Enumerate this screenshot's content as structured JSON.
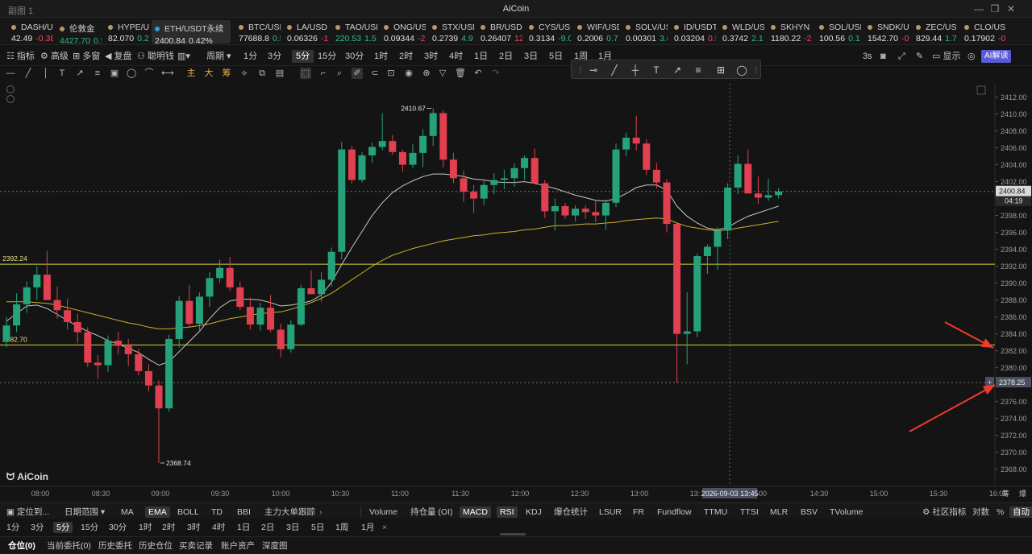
{
  "titlebar": {
    "window_label": "副图 1",
    "app_title": "AiCoin"
  },
  "tickers": [
    {
      "name": "DASH/U",
      "price": "42.49",
      "change": "-0.38",
      "dir": "dn"
    },
    {
      "name": "伦敦金",
      "price": "4427.70",
      "change": "0.5",
      "dir": "up"
    },
    {
      "name": "HYPE/U",
      "price": "82.070",
      "change": "0.2",
      "dir": "up"
    },
    {
      "name": "ETH/USDT永续",
      "price": "2400.84",
      "change": "0.42%",
      "dir": "up"
    },
    {
      "name": "BTC/USD",
      "price": "77688.8",
      "change": "0.5",
      "dir": "up"
    },
    {
      "name": "LA/USD",
      "price": "0.06326",
      "change": "-1",
      "dir": "dn"
    },
    {
      "name": "TAO/USD",
      "price": "220.53",
      "change": "1.5",
      "dir": "up"
    },
    {
      "name": "ONG/US",
      "price": "0.09344",
      "change": "-2",
      "dir": "dn"
    },
    {
      "name": "STX/USD",
      "price": "0.2739",
      "change": "4.9",
      "dir": "up"
    },
    {
      "name": "BR/USD",
      "price": "0.26407",
      "change": "12",
      "dir": "dn"
    },
    {
      "name": "CYS/USD",
      "price": "0.3134",
      "change": "-9.0",
      "dir": "up"
    },
    {
      "name": "WIF/USD",
      "price": "0.2006",
      "change": "0.7",
      "dir": "up"
    },
    {
      "name": "SOLV/US",
      "price": "0.00301",
      "change": "3.6",
      "dir": "up"
    },
    {
      "name": "ID/USDT",
      "price": "0.03204",
      "change": "0.5",
      "dir": "dn"
    },
    {
      "name": "WLD/US",
      "price": "0.3742",
      "change": "2.1",
      "dir": "up"
    },
    {
      "name": "SKHYN",
      "price": "1180.22",
      "change": "-2",
      "dir": "dn"
    },
    {
      "name": "SOL/USD",
      "price": "100.56",
      "change": "0.1",
      "dir": "up"
    },
    {
      "name": "SNDK/U",
      "price": "1542.70",
      "change": "-0",
      "dir": "dn"
    },
    {
      "name": "ZEC/US",
      "price": "829.44",
      "change": "1.7",
      "dir": "up"
    },
    {
      "name": "CLO/US",
      "price": "0.17902",
      "change": "-0",
      "dir": "dn"
    }
  ],
  "toolbar1": {
    "indicators": "指标",
    "advanced": "高级",
    "multi": "多窗",
    "replay": "复盘",
    "smart_money": "聪明钱",
    "period": "周期",
    "intervals": [
      "1分",
      "3分",
      "5分",
      "15分",
      "30分",
      "1时",
      "2时",
      "3时",
      "4时",
      "1日",
      "2日",
      "3日",
      "5日",
      "1周",
      "1月"
    ],
    "selected_interval": "5分",
    "refresh": "3s",
    "display": "显示",
    "ai": "AI解读"
  },
  "chart": {
    "watermark": "AiCoin",
    "hline_top_label": "2392.24",
    "hline_bottom_label": "2382.70",
    "high_label": "2410.67",
    "low_label": "2368.74",
    "current_price": "2400.84",
    "countdown": "04:19",
    "cursor_price": "2378.25",
    "cursor_time": "2026-09-03 13:45",
    "time_labels": [
      "08:00",
      "08:30",
      "09:00",
      "09:30",
      "10:00",
      "10:30",
      "11:00",
      "11:30",
      "12:00",
      "12:30",
      "13:00",
      "13:",
      "00",
      "14:30",
      "15:00",
      "15:30",
      "16:00"
    ],
    "price_labels": [
      "2412.00",
      "2410.00",
      "2408.00",
      "2406.00",
      "2404.00",
      "2402.00",
      "2398.00",
      "2396.00",
      "2394.00",
      "2392.00",
      "2390.00",
      "2388.00",
      "2386.00",
      "2384.00",
      "2382.00",
      "2380.00",
      "2376.00",
      "2374.00",
      "2372.00",
      "2370.00",
      "2368.00"
    ],
    "corner_labels": [
      "筹",
      "爆"
    ]
  },
  "chart_data": {
    "type": "candlestick",
    "title": "ETH/USDT永续 5分",
    "candles": [
      [
        2383.2,
        2386,
        2382.4,
        2385
      ],
      [
        2385,
        2388.8,
        2384.2,
        2387.5
      ],
      [
        2387.5,
        2390.2,
        2386.5,
        2389.5
      ],
      [
        2389.5,
        2392,
        2388,
        2391
      ],
      [
        2391,
        2393.8,
        2389.2,
        2388
      ],
      [
        2388,
        2389.6,
        2385.8,
        2386.8
      ],
      [
        2386.8,
        2388.2,
        2384.5,
        2385.4
      ],
      [
        2385.4,
        2386.4,
        2382.9,
        2384.2
      ],
      [
        2384.2,
        2384.8,
        2380.1,
        2380.6
      ],
      [
        2380.6,
        2381.5,
        2378.7,
        2380.3
      ],
      [
        2380.3,
        2383.8,
        2379.5,
        2383.2
      ],
      [
        2383.2,
        2384.2,
        2381.6,
        2382.6
      ],
      [
        2382.6,
        2383.4,
        2380.2,
        2381.6
      ],
      [
        2381.6,
        2382.2,
        2379.1,
        2379.6
      ],
      [
        2379.6,
        2380.4,
        2377.2,
        2377.9
      ],
      [
        2377.9,
        2378.5,
        2368.74,
        2375.2
      ],
      [
        2375.2,
        2383.9,
        2374.8,
        2383.4
      ],
      [
        2383.4,
        2388.5,
        2382.4,
        2387.9
      ],
      [
        2387.9,
        2389.8,
        2384.8,
        2385.2
      ],
      [
        2385.2,
        2388.9,
        2384.2,
        2388.4
      ],
      [
        2388.4,
        2391.3,
        2387.2,
        2390.6
      ],
      [
        2390.6,
        2392.8,
        2390,
        2391.8
      ],
      [
        2391.8,
        2393.1,
        2389.1,
        2389.5
      ],
      [
        2389.5,
        2390.2,
        2386.8,
        2387.2
      ],
      [
        2387.2,
        2388.3,
        2384.5,
        2385.1
      ],
      [
        2385.1,
        2387.7,
        2384.4,
        2387.1
      ],
      [
        2387.1,
        2388.6,
        2384.2,
        2384.5
      ],
      [
        2384.5,
        2385.2,
        2381.2,
        2382.2
      ],
      [
        2382.2,
        2385.6,
        2381.8,
        2385.1
      ],
      [
        2385.1,
        2389.8,
        2384.9,
        2389.4
      ],
      [
        2389.4,
        2391.5,
        2388.7,
        2388.7
      ],
      [
        2388.7,
        2391.3,
        2387.8,
        2390.4
      ],
      [
        2390.4,
        2394.2,
        2389.6,
        2393.7
      ],
      [
        2393.7,
        2406.7,
        2392.8,
        2405.8
      ],
      [
        2405.8,
        2406.2,
        2401.8,
        2402.2
      ],
      [
        2402.2,
        2405.5,
        2401.9,
        2405.1
      ],
      [
        2405.1,
        2406.6,
        2404.2,
        2406.1
      ],
      [
        2406.1,
        2410.1,
        2405.7,
        2406.8
      ],
      [
        2406.8,
        2407.5,
        2405.2,
        2405.5
      ],
      [
        2405.5,
        2405.8,
        2403.2,
        2404
      ],
      [
        2404,
        2406.4,
        2403.6,
        2405.4
      ],
      [
        2405.4,
        2408.2,
        2403.7,
        2407.4
      ],
      [
        2407.4,
        2410.67,
        2406.2,
        2410.1
      ],
      [
        2410.1,
        2410.4,
        2403.7,
        2404.6
      ],
      [
        2404.6,
        2405.4,
        2401.8,
        2402.4
      ],
      [
        2402.4,
        2403.3,
        2399.6,
        2400.8
      ],
      [
        2400.8,
        2401.6,
        2398.3,
        2400
      ],
      [
        2400,
        2402.1,
        2399.2,
        2401.6
      ],
      [
        2401.6,
        2403,
        2400.5,
        2402.2
      ],
      [
        2402.2,
        2403.4,
        2401.1,
        2402.4
      ],
      [
        2402.4,
        2404.2,
        2401.4,
        2403.6
      ],
      [
        2403.6,
        2405.1,
        2402.2,
        2404.8
      ],
      [
        2404.8,
        2405.9,
        2401.7,
        2401.8
      ],
      [
        2401.8,
        2402.2,
        2397.7,
        2398.5
      ],
      [
        2398.5,
        2400,
        2396.2,
        2399.1
      ],
      [
        2399.1,
        2399.5,
        2397.6,
        2398
      ],
      [
        2398,
        2399.2,
        2397.3,
        2398.8
      ],
      [
        2398.8,
        2399.2,
        2397.6,
        2398.4
      ],
      [
        2398.4,
        2399.8,
        2397.2,
        2398
      ],
      [
        2398,
        2399.9,
        2396.3,
        2399.5
      ],
      [
        2399.5,
        2406.5,
        2399,
        2405.8
      ],
      [
        2405.8,
        2407.8,
        2405,
        2407.2
      ],
      [
        2407.2,
        2409.8,
        2405.7,
        2406.5
      ],
      [
        2406.5,
        2407,
        2402.8,
        2403.4
      ],
      [
        2403.4,
        2404.2,
        2401.2,
        2401.9
      ],
      [
        2401.9,
        2402.3,
        2396,
        2397
      ],
      [
        2397,
        2397.2,
        2378.25,
        2384
      ],
      [
        2384,
        2388.9,
        2380.4,
        2384.3
      ],
      [
        2384.3,
        2393.5,
        2383.6,
        2393.2
      ],
      [
        2393.2,
        2394.6,
        2391.1,
        2394.3
      ],
      [
        2394.3,
        2396.6,
        2391.6,
        2396.2
      ],
      [
        2396.2,
        2401.8,
        2395.2,
        2401.3
      ],
      [
        2401.3,
        2405.1,
        2400.5,
        2404.1
      ],
      [
        2404.1,
        2405.8,
        2402.4,
        2400.6
      ],
      [
        2400.6,
        2402.6,
        2399.4,
        2400.1
      ],
      [
        2400.1,
        2402.3,
        2399.7,
        2400.4
      ],
      [
        2400.4,
        2401.2,
        2400,
        2400.84
      ]
    ],
    "ma_fast": [
      2385.5,
      2386.4,
      2387.3,
      2387.4,
      2387,
      2386.3,
      2385.6,
      2384.9,
      2384.3,
      2383.8,
      2383.2,
      2382.8,
      2382.3,
      2381.8,
      2381,
      2380.3,
      2380.7,
      2381.9,
      2383.1,
      2384.3,
      2385.8,
      2387.1,
      2387.9,
      2388.1,
      2388.1,
      2388,
      2387.7,
      2387.3,
      2387.4,
      2387.6,
      2387.9,
      2388.6,
      2390.1,
      2392.2,
      2394.2,
      2396.1,
      2398,
      2399.5,
      2400.7,
      2401.5,
      2402.1,
      2402.6,
      2402.9,
      2402.9,
      2402.8,
      2402.6,
      2402.3,
      2402.2,
      2402,
      2401.9,
      2401.9,
      2402,
      2401.8,
      2401.5,
      2401.2,
      2400.8,
      2400.4,
      2400.1,
      2399.8,
      2399.7,
      2400,
      2400.6,
      2401.3,
      2401.6,
      2401.6,
      2401,
      2399.1,
      2397.9,
      2397.1,
      2396.5,
      2396.3,
      2396.6,
      2397.3,
      2397.9,
      2398.3,
      2398.7,
      2399.1
    ],
    "ma_slow": [
      2387.8,
      2387.8,
      2387.8,
      2387.7,
      2387.6,
      2387.4,
      2387.1,
      2386.8,
      2386.5,
      2386.2,
      2385.9,
      2385.6,
      2385.3,
      2385.1,
      2384.8,
      2384.6,
      2384.6,
      2384.7,
      2384.8,
      2385,
      2385.2,
      2385.5,
      2385.8,
      2386,
      2386.2,
      2386.4,
      2386.5,
      2386.6,
      2386.9,
      2387.3,
      2387.7,
      2388.2,
      2388.8,
      2389.6,
      2390.4,
      2391.2,
      2392,
      2392.7,
      2393.3,
      2393.7,
      2394.1,
      2394.4,
      2394.7,
      2395,
      2395.2,
      2395.4,
      2395.6,
      2395.7,
      2395.9,
      2396,
      2396.1,
      2396.3,
      2396.4,
      2396.6,
      2396.8,
      2396.8,
      2396.9,
      2397,
      2397,
      2397.1,
      2397.2,
      2397.4,
      2397.5,
      2397.6,
      2397.7,
      2397.6,
      2397.1,
      2396.7,
      2396.5,
      2396.3,
      2396.2,
      2396.3,
      2396.5,
      2396.7,
      2396.9,
      2397.1,
      2397.3
    ],
    "hlines": [
      2392.24,
      2382.7
    ],
    "ylim": [
      2367.5,
      2413
    ]
  },
  "bottom1": {
    "locate": "定位到...",
    "range": "日期范围",
    "left_indicators": [
      "MA",
      "EMA",
      "BOLL",
      "TD",
      "BBI",
      "主力大单跟踪"
    ],
    "selected_left": "EMA",
    "right_indicators": [
      "Volume",
      "持仓量 (OI)",
      "MACD",
      "RSI",
      "KDJ",
      "爆仓统计",
      "LSUR",
      "FR",
      "Fundflow",
      "TTMU",
      "TTSI",
      "MLR",
      "BSV",
      "TVolume"
    ],
    "selected_right": [
      "MACD",
      "RSI"
    ],
    "community": "社区指标",
    "compare": "对数",
    "pct": "%",
    "auto": "自动"
  },
  "bottom2": {
    "intervals": [
      "1分",
      "3分",
      "5分",
      "15分",
      "30分",
      "1时",
      "2时",
      "3时",
      "4时",
      "1日",
      "2日",
      "3日",
      "5日",
      "1周",
      "1月"
    ],
    "selected": "5分",
    "close": "×"
  },
  "bottom3": {
    "tabs": [
      "仓位(0)",
      "当前委托(0)",
      "历史委托",
      "历史仓位",
      "买卖记录",
      "账户资产",
      "深度图"
    ]
  }
}
